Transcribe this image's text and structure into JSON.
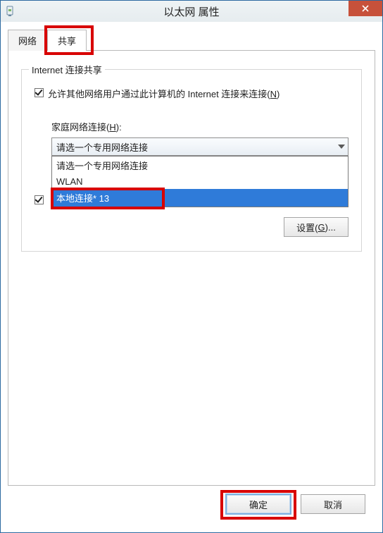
{
  "window": {
    "title": "以太网 属性"
  },
  "tabs": {
    "network": "网络",
    "sharing": "共享"
  },
  "group": {
    "title": "Internet 连接共享",
    "allow_connect_prefix": "允许其他网络用户通过此计算机的 Internet 连接来连接(",
    "allow_connect_hotkey": "N",
    "allow_connect_suffix": ")",
    "home_net_prefix": "家庭网络连接(",
    "home_net_hotkey": "H",
    "home_net_suffix": "):",
    "combo_selected": "请选一个专用网络连接",
    "combo_options": {
      "opt0": "请选一个专用网络连接",
      "opt1": "WLAN",
      "opt2": "本地连接* 13"
    },
    "settings_btn_prefix": "设置(",
    "settings_btn_hotkey": "G",
    "settings_btn_suffix": ")..."
  },
  "buttons": {
    "ok": "确定",
    "cancel": "取消"
  }
}
